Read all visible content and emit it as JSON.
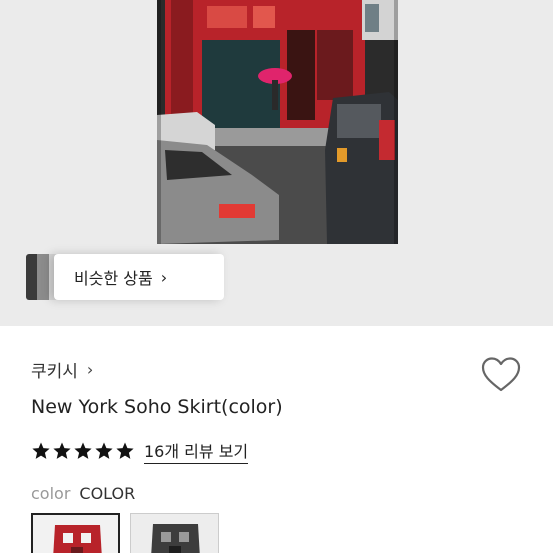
{
  "similar": {
    "label": "비슷한 상품",
    "chevron": "›"
  },
  "shop": {
    "name": "쿠키시",
    "chevron": "›"
  },
  "product": {
    "title": "New York Soho Skirt(color)"
  },
  "rating": {
    "stars": 5,
    "review_link": "16개 리뷰 보기"
  },
  "option": {
    "key": "color",
    "value": "COLOR"
  },
  "swatches": [
    {
      "name": "color",
      "selected": true
    },
    {
      "name": "black-white",
      "selected": false
    }
  ],
  "icons": [
    "heart-icon",
    "star-icon",
    "chevron-right-icon"
  ],
  "colors": {
    "star": "#111111",
    "heart_outline": "#666666",
    "hero_bg": "#ebebeb"
  }
}
